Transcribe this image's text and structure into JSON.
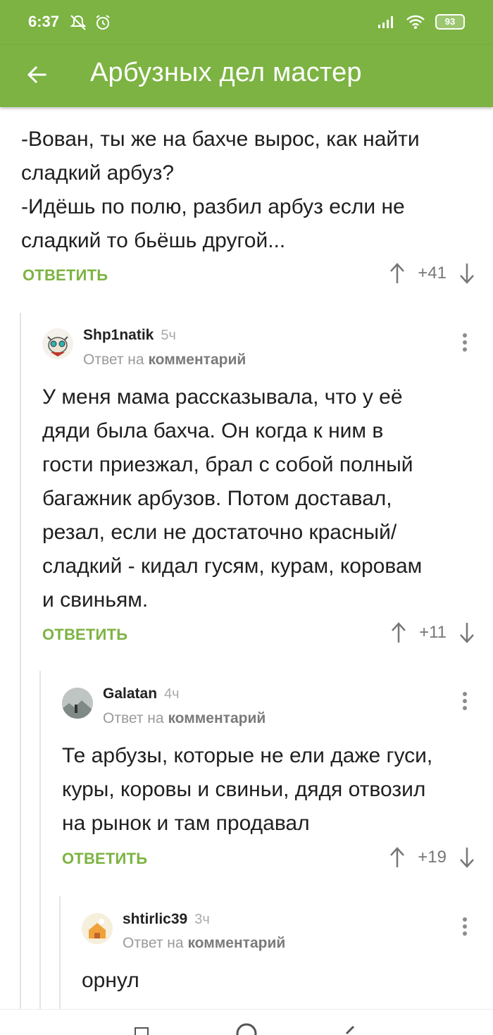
{
  "status": {
    "time": "6:37",
    "battery": "93"
  },
  "appbar": {
    "title": "Арбузных дел мастер"
  },
  "root_comment": {
    "lines": [
      "-Вован, ты же на бахче вырос, как найти",
      "сладкий арбуз?",
      "-Идёшь по полю, разбил арбуз если не",
      "сладкий то бьёшь другой..."
    ],
    "reply_label": "ОТВЕТИТЬ",
    "rating": "+41"
  },
  "comments": [
    {
      "author": "Shp1natik",
      "time": "5ч",
      "reply_prefix": "Ответ на",
      "reply_target": "комментарий",
      "lines": [
        "У меня мама рассказывала, что у её",
        "дяди была бахча. Он когда к ним в",
        "гости приезжал, брал с собой полный",
        "багажник арбузов. Потом доставал,",
        "резал, если не достаточно красный/",
        "сладкий - кидал гусям, курам, коровам",
        "и свиньям."
      ],
      "reply_label": "ОТВЕТИТЬ",
      "rating": "+11"
    },
    {
      "author": "Galatan",
      "time": "4ч",
      "reply_prefix": "Ответ на",
      "reply_target": "комментарий",
      "lines": [
        "Те арбузы, которые не ели даже гуси,",
        "куры, коровы и свиньи, дядя отвозил",
        "на рынок и там продавал"
      ],
      "reply_label": "ОТВЕТИТЬ",
      "rating": "+19"
    },
    {
      "author": "shtirlic39",
      "time": "3ч",
      "reply_prefix": "Ответ на",
      "reply_target": "комментарий",
      "lines": [
        "орнул"
      ]
    }
  ],
  "colors": {
    "brand_green": "#7cb342",
    "muted_text": "#9a9a9a"
  },
  "icons": [
    "back-arrow-icon",
    "arrow-up-icon",
    "arrow-down-icon",
    "more-vert-icon",
    "wifi-icon",
    "signal-icon",
    "alarm-icon",
    "mute-bell-icon"
  ]
}
